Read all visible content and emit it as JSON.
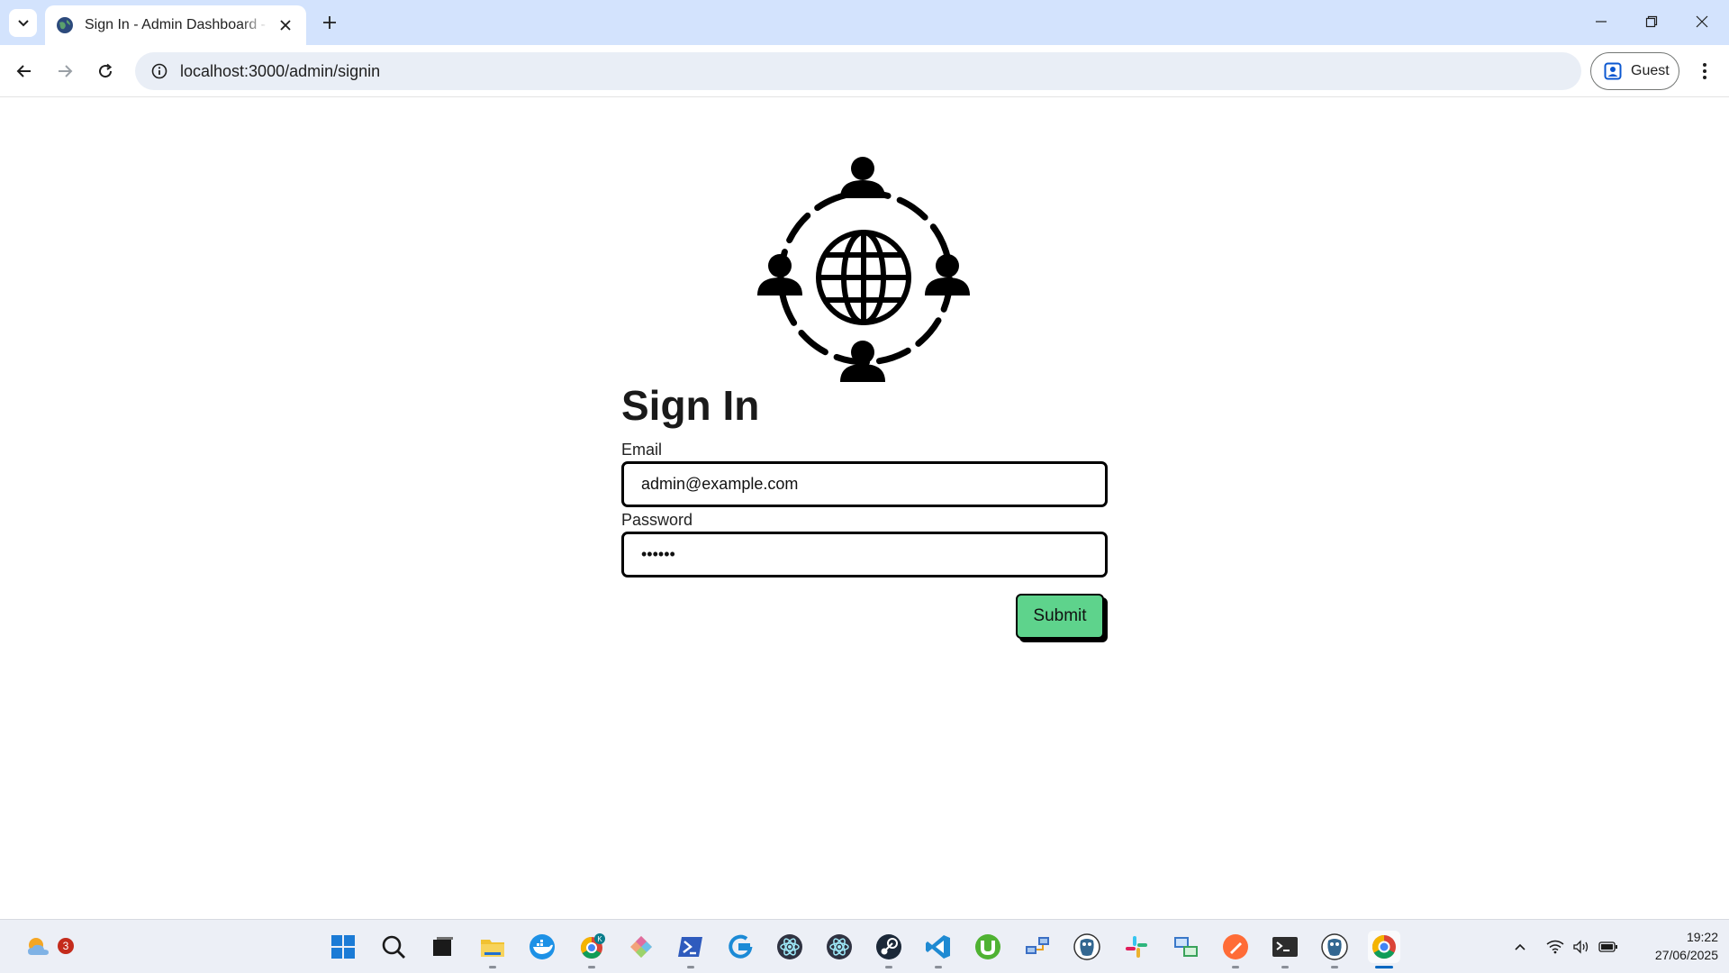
{
  "browser": {
    "tab": {
      "title": "Sign In - Admin Dashboard - Gr"
    },
    "address_bar": {
      "url": "localhost:3000/admin/signin"
    },
    "profile": {
      "label": "Guest"
    }
  },
  "page": {
    "title": "Sign In",
    "form": {
      "email_label": "Email",
      "email_value": "admin@example.com",
      "password_label": "Password",
      "password_value": "••••••",
      "submit_label": "Submit"
    },
    "colors": {
      "submit_bg": "#5ed38c",
      "border": "#000000"
    }
  },
  "taskbar": {
    "weather_badge": "3",
    "apps": [
      "start-icon",
      "search-icon",
      "task-view-icon",
      "file-explorer-icon",
      "docker-icon",
      "chrome-profile-icon",
      "git-kraken-icon",
      "powershell-icon",
      "logitech-icon",
      "electron-icon",
      "electron-icon",
      "steam-icon",
      "vscode-icon",
      "utorrent-icon",
      "network-icon",
      "pgadmin-icon",
      "slack-icon",
      "remote-icon",
      "postman-icon",
      "terminal-icon",
      "pgadmin-icon",
      "chrome-icon"
    ],
    "clock": {
      "time": "19:22",
      "date": "27/06/2025"
    }
  }
}
